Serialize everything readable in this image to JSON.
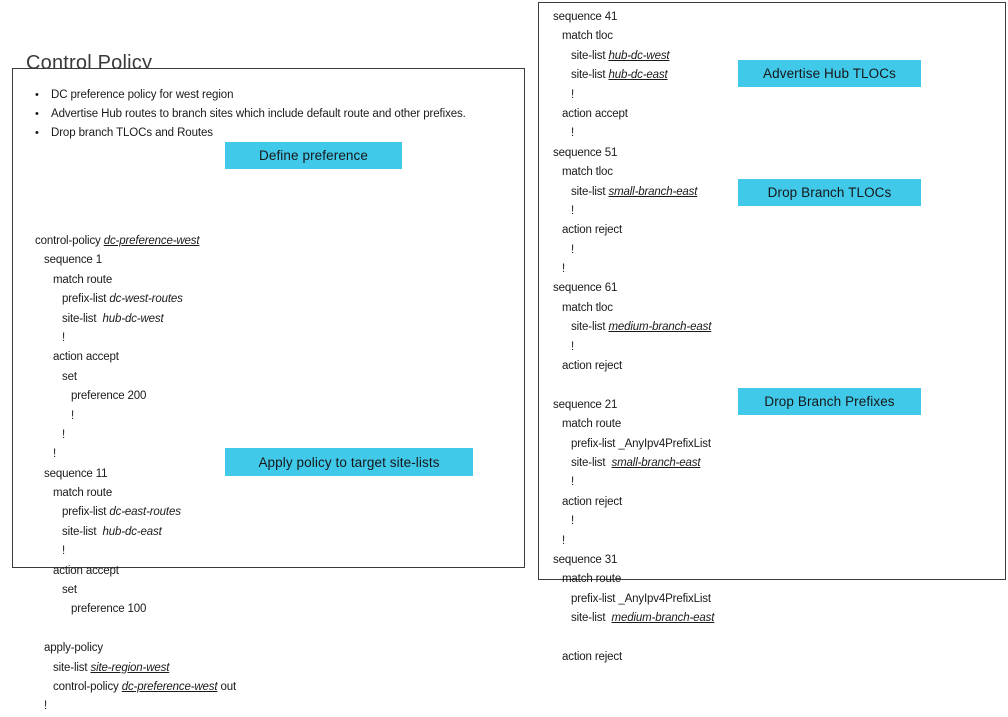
{
  "title": "Control Policy",
  "bullets": [
    "DC preference policy for west region",
    "Advertise Hub routes to branch sites which include default route and other prefixes.",
    "Drop branch TLOCs and Routes"
  ],
  "callouts": {
    "define_preference": "Define preference",
    "apply_policy": "Apply policy to target site-lists",
    "advertise_hub_tlocs": "Advertise Hub TLOCs",
    "drop_branch_tlocs": "Drop  Branch TLOCs",
    "drop_branch_prefixes": "Drop  Branch Prefixes"
  },
  "left_code": [
    {
      "indent": 0,
      "parts": [
        {
          "t": "control-policy ",
          "s": "plain"
        },
        {
          "t": "dc-preference-west",
          "s": "itu"
        }
      ]
    },
    {
      "indent": 1,
      "parts": [
        {
          "t": "sequence 1",
          "s": "plain"
        }
      ]
    },
    {
      "indent": 2,
      "parts": [
        {
          "t": "match route",
          "s": "plain"
        }
      ]
    },
    {
      "indent": 3,
      "parts": [
        {
          "t": "prefix-list ",
          "s": "plain"
        },
        {
          "t": "dc-west-routes",
          "s": "it"
        }
      ]
    },
    {
      "indent": 3,
      "parts": [
        {
          "t": "site-list  ",
          "s": "plain"
        },
        {
          "t": "hub-dc-west",
          "s": "it"
        }
      ]
    },
    {
      "indent": 3,
      "parts": [
        {
          "t": "!",
          "s": "plain"
        }
      ]
    },
    {
      "indent": 2,
      "parts": [
        {
          "t": "action accept",
          "s": "plain"
        }
      ]
    },
    {
      "indent": 3,
      "parts": [
        {
          "t": "set",
          "s": "plain"
        }
      ]
    },
    {
      "indent": 4,
      "parts": [
        {
          "t": "preference 200",
          "s": "plain"
        }
      ]
    },
    {
      "indent": 4,
      "parts": [
        {
          "t": "!",
          "s": "plain"
        }
      ]
    },
    {
      "indent": 3,
      "parts": [
        {
          "t": "!",
          "s": "plain"
        }
      ]
    },
    {
      "indent": 2,
      "parts": [
        {
          "t": "!",
          "s": "plain"
        }
      ]
    },
    {
      "indent": 1,
      "parts": [
        {
          "t": "sequence 11",
          "s": "plain"
        }
      ]
    },
    {
      "indent": 2,
      "parts": [
        {
          "t": "match route",
          "s": "plain"
        }
      ]
    },
    {
      "indent": 3,
      "parts": [
        {
          "t": "prefix-list ",
          "s": "plain"
        },
        {
          "t": "dc-east-routes",
          "s": "it"
        }
      ]
    },
    {
      "indent": 3,
      "parts": [
        {
          "t": "site-list  ",
          "s": "plain"
        },
        {
          "t": "hub-dc-east",
          "s": "it"
        }
      ]
    },
    {
      "indent": 3,
      "parts": [
        {
          "t": "!",
          "s": "plain"
        }
      ]
    },
    {
      "indent": 2,
      "parts": [
        {
          "t": "action accept",
          "s": "plain"
        }
      ]
    },
    {
      "indent": 3,
      "parts": [
        {
          "t": "set",
          "s": "plain"
        }
      ]
    },
    {
      "indent": 4,
      "parts": [
        {
          "t": "preference 100",
          "s": "plain"
        }
      ]
    },
    {
      "indent": 0,
      "parts": [
        {
          "t": "",
          "s": "plain"
        }
      ]
    },
    {
      "indent": 1,
      "parts": [
        {
          "t": "apply-policy",
          "s": "plain"
        }
      ]
    },
    {
      "indent": 2,
      "parts": [
        {
          "t": "site-list ",
          "s": "plain"
        },
        {
          "t": "site-region-west",
          "s": "itu"
        }
      ]
    },
    {
      "indent": 2,
      "parts": [
        {
          "t": "control-policy ",
          "s": "plain"
        },
        {
          "t": "dc-preference-west",
          "s": "itu"
        },
        {
          "t": " out",
          "s": "plain"
        }
      ]
    },
    {
      "indent": 1,
      "parts": [
        {
          "t": "!",
          "s": "plain"
        }
      ]
    }
  ],
  "right_code": [
    {
      "indent": 0,
      "parts": [
        {
          "t": "sequence 41",
          "s": "plain"
        }
      ]
    },
    {
      "indent": 1,
      "parts": [
        {
          "t": "match tloc",
          "s": "plain"
        }
      ]
    },
    {
      "indent": 2,
      "parts": [
        {
          "t": "site-list ",
          "s": "plain"
        },
        {
          "t": "hub-dc-west",
          "s": "itu"
        }
      ]
    },
    {
      "indent": 2,
      "parts": [
        {
          "t": "site-list ",
          "s": "plain"
        },
        {
          "t": "hub-dc-east",
          "s": "itu"
        }
      ]
    },
    {
      "indent": 2,
      "parts": [
        {
          "t": "!",
          "s": "plain"
        }
      ]
    },
    {
      "indent": 1,
      "parts": [
        {
          "t": "action accept",
          "s": "plain"
        }
      ]
    },
    {
      "indent": 2,
      "parts": [
        {
          "t": "!",
          "s": "plain"
        }
      ]
    },
    {
      "indent": 0,
      "parts": [
        {
          "t": "sequence 51",
          "s": "plain"
        }
      ]
    },
    {
      "indent": 1,
      "parts": [
        {
          "t": "match tloc",
          "s": "plain"
        }
      ]
    },
    {
      "indent": 2,
      "parts": [
        {
          "t": "site-list ",
          "s": "plain"
        },
        {
          "t": "small-branch-east",
          "s": "itu"
        }
      ]
    },
    {
      "indent": 2,
      "parts": [
        {
          "t": "!",
          "s": "plain"
        }
      ]
    },
    {
      "indent": 1,
      "parts": [
        {
          "t": "action reject",
          "s": "plain"
        }
      ]
    },
    {
      "indent": 2,
      "parts": [
        {
          "t": "!",
          "s": "plain"
        }
      ]
    },
    {
      "indent": 1,
      "parts": [
        {
          "t": "!",
          "s": "plain"
        }
      ]
    },
    {
      "indent": 0,
      "parts": [
        {
          "t": "sequence 61",
          "s": "plain"
        }
      ]
    },
    {
      "indent": 1,
      "parts": [
        {
          "t": "match tloc",
          "s": "plain"
        }
      ]
    },
    {
      "indent": 2,
      "parts": [
        {
          "t": "site-list ",
          "s": "plain"
        },
        {
          "t": "medium-branch-east",
          "s": "itu"
        }
      ]
    },
    {
      "indent": 2,
      "parts": [
        {
          "t": "!",
          "s": "plain"
        }
      ]
    },
    {
      "indent": 1,
      "parts": [
        {
          "t": "action reject",
          "s": "plain"
        }
      ]
    },
    {
      "indent": 0,
      "parts": [
        {
          "t": "",
          "s": "plain"
        }
      ]
    },
    {
      "indent": 0,
      "parts": [
        {
          "t": "sequence 21",
          "s": "plain"
        }
      ]
    },
    {
      "indent": 1,
      "parts": [
        {
          "t": "match route",
          "s": "plain"
        }
      ]
    },
    {
      "indent": 2,
      "parts": [
        {
          "t": "prefix-list _AnyIpv4PrefixList",
          "s": "plain"
        }
      ]
    },
    {
      "indent": 2,
      "parts": [
        {
          "t": "site-list  ",
          "s": "plain"
        },
        {
          "t": "small-branch-east",
          "s": "itu"
        }
      ]
    },
    {
      "indent": 2,
      "parts": [
        {
          "t": "!",
          "s": "plain"
        }
      ]
    },
    {
      "indent": 1,
      "parts": [
        {
          "t": "action reject",
          "s": "plain"
        }
      ]
    },
    {
      "indent": 2,
      "parts": [
        {
          "t": "!",
          "s": "plain"
        }
      ]
    },
    {
      "indent": 1,
      "parts": [
        {
          "t": "!",
          "s": "plain"
        }
      ]
    },
    {
      "indent": 0,
      "parts": [
        {
          "t": "sequence 31",
          "s": "plain"
        }
      ]
    },
    {
      "indent": 1,
      "parts": [
        {
          "t": "match route",
          "s": "plain"
        }
      ]
    },
    {
      "indent": 2,
      "parts": [
        {
          "t": "prefix-list _AnyIpv4PrefixList",
          "s": "plain"
        }
      ]
    },
    {
      "indent": 2,
      "parts": [
        {
          "t": "site-list  ",
          "s": "plain"
        },
        {
          "t": "medium-branch-east",
          "s": "itu"
        }
      ]
    },
    {
      "indent": 0,
      "parts": [
        {
          "t": "",
          "s": "plain"
        }
      ]
    },
    {
      "indent": 1,
      "parts": [
        {
          "t": "action reject",
          "s": "plain"
        }
      ]
    }
  ],
  "colors": {
    "callout_bg": "#41c9ea",
    "panel_border": "#3b3b3b",
    "title_color": "#3a3a3a"
  }
}
